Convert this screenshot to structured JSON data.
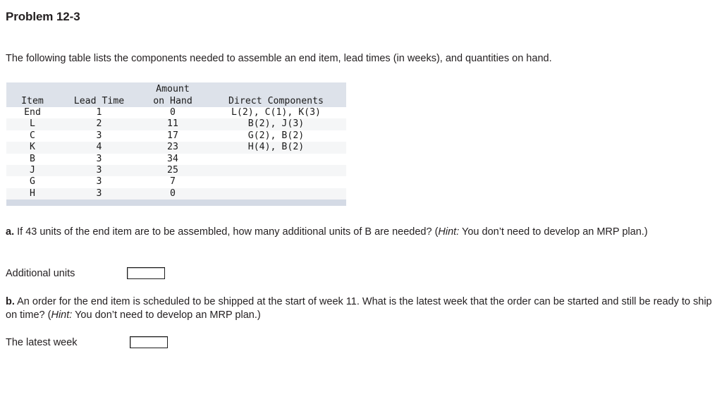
{
  "problem": {
    "title": "Problem 12-3",
    "intro": "The following table lists the components needed to assemble an end item, lead times (in weeks), and quantities on hand."
  },
  "table": {
    "headers": [
      "Item",
      "Lead Time",
      "Amount\non Hand",
      "Direct Components"
    ],
    "header_lines": {
      "item": "Item",
      "lead_time": "Lead Time",
      "amount_on_hand_line1": "Amount",
      "amount_on_hand_line2": "on Hand",
      "direct_components": "Direct Components"
    },
    "rows": [
      {
        "item": "End",
        "lead_time": "1",
        "amount_on_hand": "0",
        "direct_components": "L(2), C(1), K(3)"
      },
      {
        "item": "L",
        "lead_time": "2",
        "amount_on_hand": "11",
        "direct_components": "B(2), J(3)"
      },
      {
        "item": "C",
        "lead_time": "3",
        "amount_on_hand": "17",
        "direct_components": "G(2), B(2)"
      },
      {
        "item": "K",
        "lead_time": "4",
        "amount_on_hand": "23",
        "direct_components": "H(4), B(2)"
      },
      {
        "item": "B",
        "lead_time": "3",
        "amount_on_hand": "34",
        "direct_components": ""
      },
      {
        "item": "J",
        "lead_time": "3",
        "amount_on_hand": "25",
        "direct_components": ""
      },
      {
        "item": "G",
        "lead_time": "3",
        "amount_on_hand": "7",
        "direct_components": ""
      },
      {
        "item": "H",
        "lead_time": "3",
        "amount_on_hand": "0",
        "direct_components": ""
      }
    ],
    "header_bg_color": "#dde2ea",
    "stripe_color": "#f5f6f7",
    "footer_bar_color": "#d4dae5"
  },
  "questions": {
    "a": {
      "label": "a.",
      "text_before_hint": " If 43 units of the end item are to be assembled, how many additional units of B are needed? (",
      "hint_word": "Hint:",
      "text_after_hint": " You don’t need to develop an MRP plan.)",
      "answer_label": "Additional units",
      "answer_value": "",
      "answer_placeholder": ""
    },
    "b": {
      "label": "b.",
      "text_before_hint": " An order for the end item is scheduled to be shipped at the start of week 11. What is the latest week that the order can be started and still be ready to ship on time? (",
      "hint_word": "Hint:",
      "text_after_hint": " You don’t need to develop an MRP plan.)",
      "answer_label": "The latest week",
      "answer_value": "",
      "answer_placeholder": ""
    }
  }
}
